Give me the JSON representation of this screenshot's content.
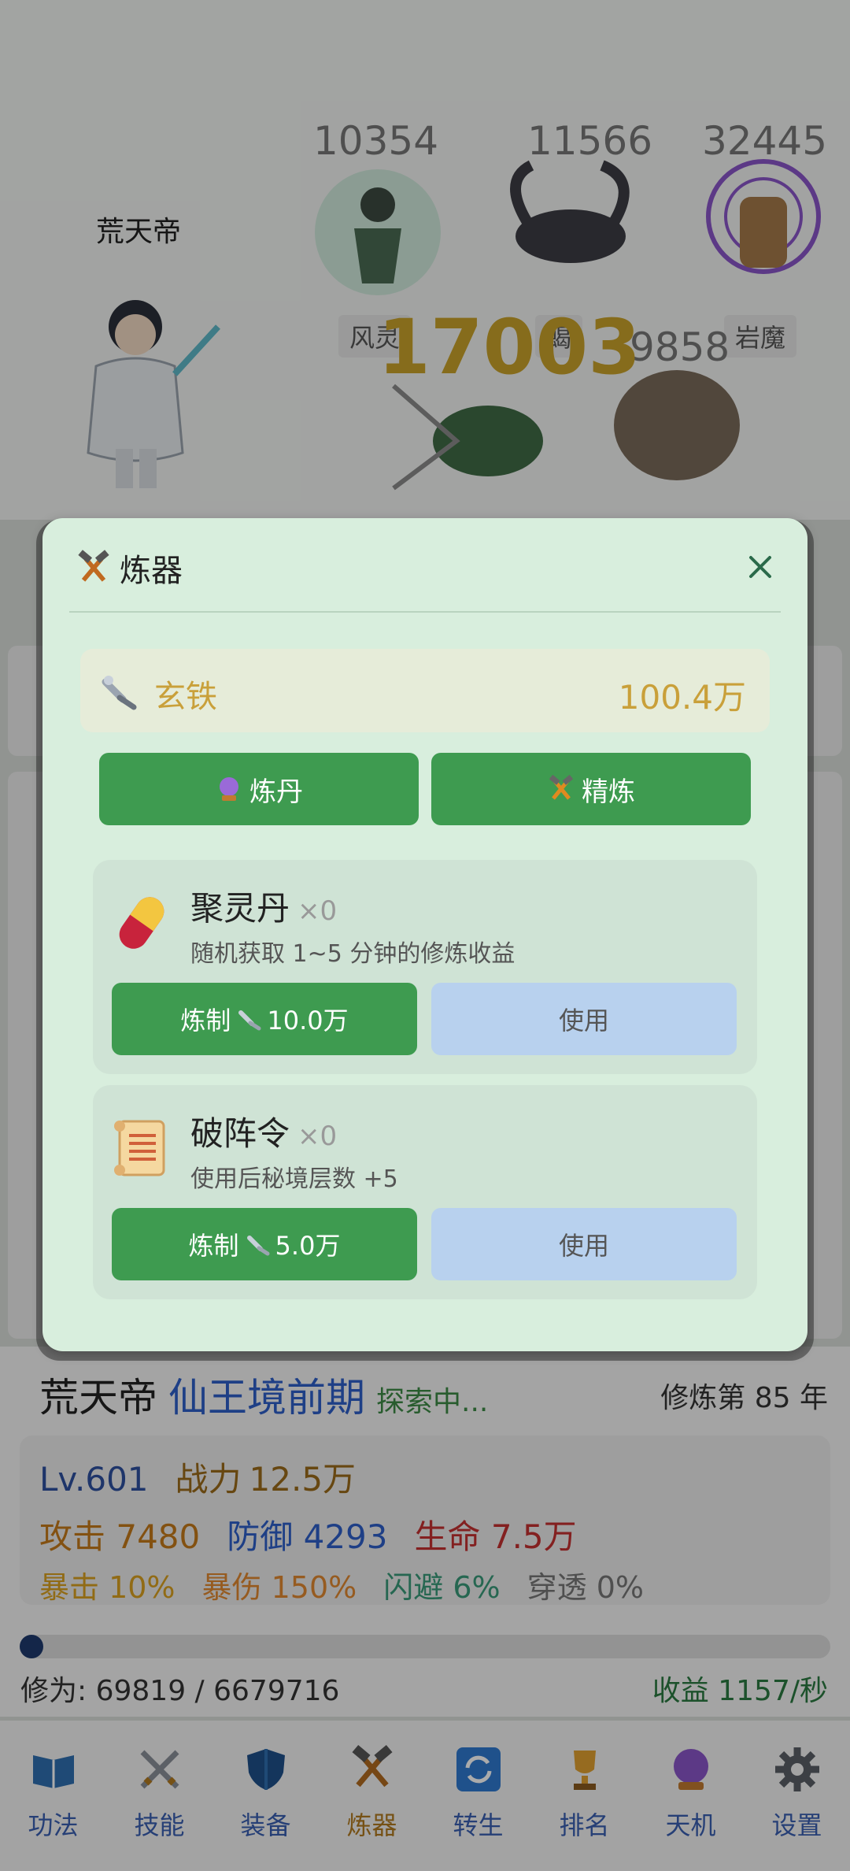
{
  "scene": {
    "player_name": "荒天帝",
    "enemies": [
      {
        "hp": "10354",
        "tag": "风灵"
      },
      {
        "hp": "11566",
        "tag": "蝎"
      },
      {
        "hp": "32445",
        "tag": "岩魔"
      },
      {
        "hp": "9858",
        "tag": ""
      }
    ],
    "damage_float": "17003"
  },
  "status": {
    "name": "荒天帝",
    "realm": "仙王境前期",
    "state": "探索中...",
    "year": "修炼第 85 年",
    "level": "Lv.601",
    "power_label": "战力",
    "power": "12.5万",
    "attack": "攻击 7480",
    "defense": "防御 4293",
    "hp": "生命 7.5万",
    "crit": "暴击 10%",
    "crit_dmg": "暴伤 150%",
    "dodge": "闪避 6%",
    "pierce": "穿透 0%",
    "exp_text": "修为: 69819 / 6679716",
    "exp_progress": 0.0105,
    "income": "收益 1157/秒"
  },
  "modal": {
    "title": "炼器",
    "resource_name": "玄铁",
    "resource_value": "100.4万",
    "tabs": [
      {
        "label": "炼丹",
        "icon": "crystal-ball-icon"
      },
      {
        "label": "精炼",
        "icon": "hammer-pick-icon"
      }
    ],
    "items": [
      {
        "name": "聚灵丹",
        "count": "×0",
        "desc": "随机获取 1~5 分钟的修炼收益",
        "craft_label": "炼制",
        "craft_cost": "10.0万",
        "use_label": "使用",
        "icon": "pill-icon"
      },
      {
        "name": "破阵令",
        "count": "×0",
        "desc": "使用后秘境层数 +5",
        "craft_label": "炼制",
        "craft_cost": "5.0万",
        "use_label": "使用",
        "icon": "scroll-icon"
      }
    ]
  },
  "nav": [
    {
      "label": "功法",
      "icon": "book-icon"
    },
    {
      "label": "技能",
      "icon": "crossed-swords-icon"
    },
    {
      "label": "装备",
      "icon": "shield-icon"
    },
    {
      "label": "炼器",
      "icon": "hammer-pick-icon"
    },
    {
      "label": "转生",
      "icon": "refresh-icon"
    },
    {
      "label": "排名",
      "icon": "trophy-icon"
    },
    {
      "label": "天机",
      "icon": "crystal-ball-icon"
    },
    {
      "label": "设置",
      "icon": "gear-icon"
    }
  ],
  "colors": {
    "accent_green": "#3e9b50",
    "modal_bg": "#d8eedd",
    "use_button": "#b8d1ee",
    "resource_gold": "#c9a03a",
    "realm_blue": "#2d5fc8"
  }
}
